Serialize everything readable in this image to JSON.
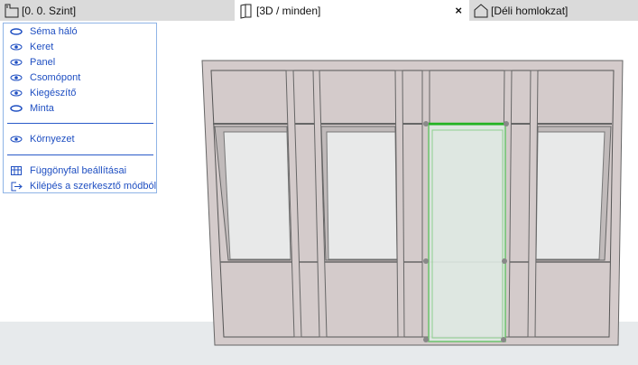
{
  "tabs": [
    {
      "label": "[0. 0. Szint]",
      "icon": "floor-plan-icon"
    },
    {
      "label": "[3D / minden]",
      "icon": "3d-window-icon",
      "active": true,
      "close": "×"
    },
    {
      "label": "[Déli homlokzat]",
      "icon": "elevation-icon"
    }
  ],
  "menu": {
    "items": [
      {
        "label": "Séma háló",
        "icon": "eye-closed-icon"
      },
      {
        "label": "Keret",
        "icon": "eye-icon"
      },
      {
        "label": "Panel",
        "icon": "eye-icon"
      },
      {
        "label": "Csomópont",
        "icon": "eye-icon"
      },
      {
        "label": "Kiegészítő",
        "icon": "eye-icon"
      },
      {
        "label": "Minta",
        "icon": "eye-closed-icon"
      }
    ],
    "environment": {
      "label": "Környezet",
      "icon": "eye-icon"
    },
    "settings": {
      "label": "Függönyfal beállításai",
      "icon": "curtain-wall-settings-icon"
    },
    "exit": {
      "label": "Kilépés a szerkesztő módból",
      "icon": "exit-icon"
    }
  },
  "colors": {
    "menu_text": "#1f4fc2",
    "selection": "#22b322",
    "panel": "#d4cbcb"
  }
}
